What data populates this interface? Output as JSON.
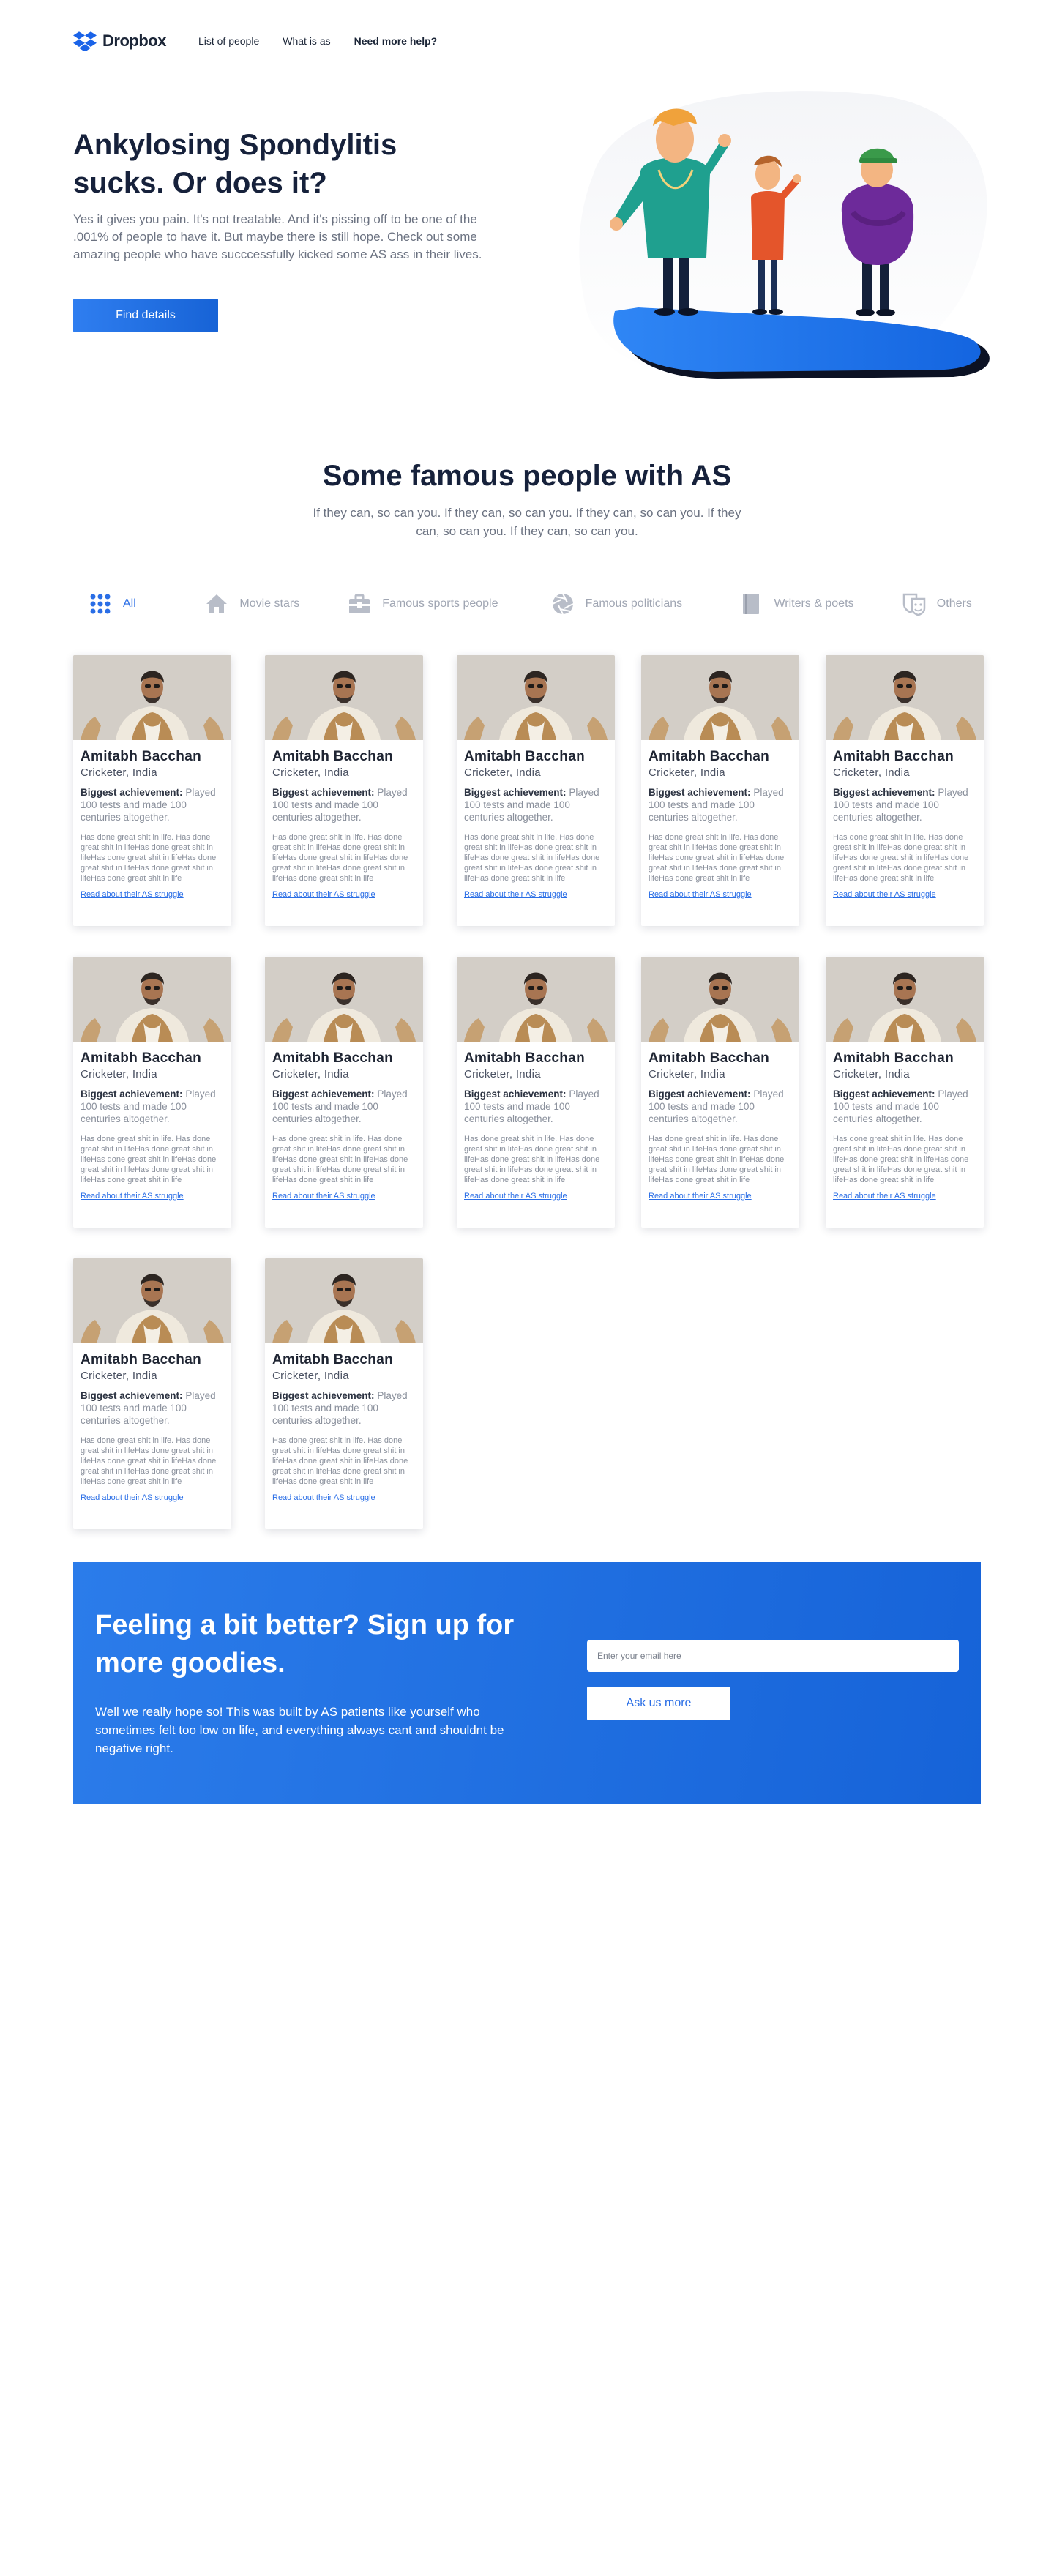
{
  "nav": {
    "brand": "Dropbox",
    "links": [
      {
        "label": "List of people"
      },
      {
        "label": "What is as"
      },
      {
        "label": "Need more help?"
      }
    ]
  },
  "hero": {
    "title": "Ankylosing Spondylitis sucks. Or does it?",
    "text": "Yes it gives you pain. It's not treatable. And it's pissing off to be one of the .001% of people to have it. But maybe there is still hope. Check out some amazing people who have succcessfully kicked some AS ass in their lives.",
    "cta": "Find details"
  },
  "famous": {
    "title": "Some famous people with AS",
    "subtitle": "If they can, so can you. If they can, so can you. If they can, so can you. If they can, so can you. If they can, so can you."
  },
  "filters": [
    {
      "label": "All",
      "icon": "grid-icon",
      "active": true
    },
    {
      "label": "Movie stars",
      "icon": "home-icon",
      "active": false
    },
    {
      "label": "Famous sports people",
      "icon": "briefcase-icon",
      "active": false
    },
    {
      "label": "Famous politicians",
      "icon": "aperture-icon",
      "active": false
    },
    {
      "label": "Writers & poets",
      "icon": "book-icon",
      "active": false
    },
    {
      "label": "Others",
      "icon": "masks-icon",
      "active": false
    }
  ],
  "cards": [
    {
      "name": "Amitabh Bacchan",
      "role": "Cricketer, India",
      "achievement_label": "Biggest achievement:",
      "achievement": "Played 100 tests and made 100 centuries altogether.",
      "description": "Has done great shit in life. Has done great shit in lifeHas done great shit in lifeHas done great shit in lifeHas done great shit in lifeHas done great shit in lifeHas done great shit in life",
      "link": "Read about their AS struggle"
    },
    {
      "name": "Amitabh Bacchan",
      "role": "Cricketer, India",
      "achievement_label": "Biggest achievement:",
      "achievement": "Played 100 tests and made 100 centuries altogether.",
      "description": "Has done great shit in life. Has done great shit in lifeHas done great shit in lifeHas done great shit in lifeHas done great shit in lifeHas done great shit in lifeHas done great shit in life",
      "link": "Read about their AS struggle"
    },
    {
      "name": "Amitabh Bacchan",
      "role": "Cricketer, India",
      "achievement_label": "Biggest achievement:",
      "achievement": "Played 100 tests and made 100 centuries altogether.",
      "description": "Has done great shit in life. Has done great shit in lifeHas done great shit in lifeHas done great shit in lifeHas done great shit in lifeHas done great shit in lifeHas done great shit in life",
      "link": "Read about their AS struggle"
    },
    {
      "name": "Amitabh Bacchan",
      "role": "Cricketer, India",
      "achievement_label": "Biggest achievement:",
      "achievement": "Played 100 tests and made 100 centuries altogether.",
      "description": "Has done great shit in life. Has done great shit in lifeHas done great shit in lifeHas done great shit in lifeHas done great shit in lifeHas done great shit in lifeHas done great shit in life",
      "link": "Read about their AS struggle"
    },
    {
      "name": "Amitabh Bacchan",
      "role": "Cricketer, India",
      "achievement_label": "Biggest achievement:",
      "achievement": "Played 100 tests and made 100 centuries altogether.",
      "description": "Has done great shit in life. Has done great shit in lifeHas done great shit in lifeHas done great shit in lifeHas done great shit in lifeHas done great shit in lifeHas done great shit in life",
      "link": "Read about their AS struggle"
    },
    {
      "name": "Amitabh Bacchan",
      "role": "Cricketer, India",
      "achievement_label": "Biggest achievement:",
      "achievement": "Played 100 tests and made 100 centuries altogether.",
      "description": "Has done great shit in life. Has done great shit in lifeHas done great shit in lifeHas done great shit in lifeHas done great shit in lifeHas done great shit in lifeHas done great shit in life",
      "link": "Read about their AS struggle"
    },
    {
      "name": "Amitabh Bacchan",
      "role": "Cricketer, India",
      "achievement_label": "Biggest achievement:",
      "achievement": "Played 100 tests and made 100 centuries altogether.",
      "description": "Has done great shit in life. Has done great shit in lifeHas done great shit in lifeHas done great shit in lifeHas done great shit in lifeHas done great shit in lifeHas done great shit in life",
      "link": "Read about their AS struggle"
    },
    {
      "name": "Amitabh Bacchan",
      "role": "Cricketer, India",
      "achievement_label": "Biggest achievement:",
      "achievement": "Played 100 tests and made 100 centuries altogether.",
      "description": "Has done great shit in life. Has done great shit in lifeHas done great shit in lifeHas done great shit in lifeHas done great shit in lifeHas done great shit in lifeHas done great shit in life",
      "link": "Read about their AS struggle"
    },
    {
      "name": "Amitabh Bacchan",
      "role": "Cricketer, India",
      "achievement_label": "Biggest achievement:",
      "achievement": "Played 100 tests and made 100 centuries altogether.",
      "description": "Has done great shit in life. Has done great shit in lifeHas done great shit in lifeHas done great shit in lifeHas done great shit in lifeHas done great shit in lifeHas done great shit in life",
      "link": "Read about their AS struggle"
    },
    {
      "name": "Amitabh Bacchan",
      "role": "Cricketer, India",
      "achievement_label": "Biggest achievement:",
      "achievement": "Played 100 tests and made 100 centuries altogether.",
      "description": "Has done great shit in life. Has done great shit in lifeHas done great shit in lifeHas done great shit in lifeHas done great shit in lifeHas done great shit in lifeHas done great shit in life",
      "link": "Read about their AS struggle"
    },
    {
      "name": "Amitabh Bacchan",
      "role": "Cricketer, India",
      "achievement_label": "Biggest achievement:",
      "achievement": "Played 100 tests and made 100 centuries altogether.",
      "description": "Has done great shit in life. Has done great shit in lifeHas done great shit in lifeHas done great shit in lifeHas done great shit in lifeHas done great shit in lifeHas done great shit in life",
      "link": "Read about their AS struggle"
    },
    {
      "name": "Amitabh Bacchan",
      "role": "Cricketer, India",
      "achievement_label": "Biggest achievement:",
      "achievement": "Played 100 tests and made 100 centuries altogether.",
      "description": "Has done great shit in life. Has done great shit in lifeHas done great shit in lifeHas done great shit in lifeHas done great shit in lifeHas done great shit in lifeHas done great shit in life",
      "link": "Read about their AS struggle"
    }
  ],
  "signup": {
    "title": "Feeling a bit better? Sign up for more goodies.",
    "text": "Well we really hope so! This was built by AS patients like yourself who sometimes felt too low on life, and everything always cant and shouldnt be negative right.",
    "email_placeholder": "Enter your email here",
    "button": "Ask us more"
  },
  "colors": {
    "accent": "#2a6ee6",
    "heading": "#16213b",
    "muted": "#6b7281"
  }
}
